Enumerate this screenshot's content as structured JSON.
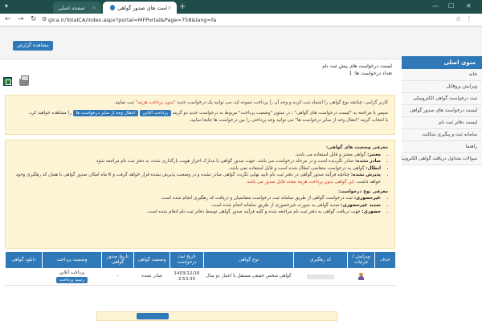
{
  "browser": {
    "tab1_title": "صفحه اصلی",
    "tab2_title": "لیست درخواست های صدور گواهی",
    "url": "gica.ir/TotalCA/index.aspx?portal=MFPortal&Page=758&lang=fa",
    "accent": "#1f4e4a"
  },
  "top": {
    "show_report": "مشاهده گزارش"
  },
  "sidebar": {
    "heading": "منوی اصلی",
    "items": [
      "خانه",
      "ویرایش پروفایل",
      "ثبت درخواست گواهی الکترونیکی",
      "لیست درخواست های صدور گواهی",
      "لیست دفاتر ثبت نام",
      "سامانه ثبت و پیگیری شکایت",
      "راهنما",
      "سوالات متداول دریافت گواهی الکترونیکی"
    ]
  },
  "summary": {
    "line1": "لیست درخواست های پیش ثبت نام",
    "line2": "تعداد درخواست ها: 1"
  },
  "note1": {
    "line1_a": "کاربر گرامی، چنانچه نوع گواهی را اشتباه ثبت کرده و وجه آن را پرداخت ننموده اید، می توانید یک درخواست جدید",
    "line1_red": "\"بدون پرداخت هزینه\"",
    "line1_b": "ثبت نمایید.",
    "line2_a": "سپس با مراجعه به \"لیست درخواست های گواهی\" ، در ستون \"وضعیت پرداخت\" مربوط به درخواست جدید دو گزینه",
    "btn_online": "پرداخت آنلاین",
    "btn_transfer": "انتقال وجه از سایر درخواست ها",
    "line2_b": "را مشاهده خواهید کرد.",
    "line3": "با انتخاب گزینه \"انتقال وجه از سایر درخواست ها\" می توانید وجه پرداختی را بین درخواست ها جابجا نمایید."
  },
  "note2": {
    "title1": "معرفی وضعیت های گواهی:",
    "s1_b": "معتبر:",
    "s1": "گواهی معتبر و قابل استفاده می باشد.",
    "s2_b": "صادر نشده:",
    "s2": "صادر نگردیده است و در مرحله درخواست می باشد. جهت صدور گواهی با مدارک احراز هویت بارگذاری شده، به دفتر ثبت نام مراجعه شود.",
    "s3_b": "ابطال:",
    "s3": "گواهی به درخواست متقاضی ابطال شده است و قابل استفاده نمی باشد.",
    "s4_b": "پذیرش نشده:",
    "s4": "چنانچه فرآیند صدور گواهی در دفتر ثبت نام تایید نهایی نگردد، گواهی صادر نشده و در وضعیت پذیرش نشده قرار خواهد گرفت و 6 ماه امکان صدور گواهی با همان کد رهگیری وجود خواهد داشت.",
    "s4_red": "این گواهی بدون پرداخت هزینه مجدد قابل صدور می باشد.",
    "title2": "معرفی نوع درخواست:",
    "t1_b": "غیرحضوری:",
    "t1": "ثبت درخواست گواهی از طریق سامانه ثبت درخواست متقاضیان و دریافت کد رهگیری انجام شده است.",
    "t2_b": "تمدید غیرحضوری:",
    "t2": "تمدید گواهی به صورت غیرحضوری از طریق سامانه انجام شده است.",
    "t3_b": "حضوری:",
    "t3": "جهت دریافت گواهی به دفتر ثبت نام مراجعه شده و کلیه فرآیند صدور گواهی توسط دفاتر ثبت نام انجام شده است."
  },
  "table": {
    "headers": {
      "download": "دانلود گواهی",
      "pay_status": "وضعیت پرداخت",
      "issue_date": "تاریخ صدور گواهی",
      "cert_status": "وضعیت گواهی",
      "reg_date": "تاریخ ثبت درخواست",
      "cert_type": "نوع گواهی",
      "tracking": "کد رهگیری",
      "edit": "ویرایش / جزئیات",
      "delete": "حذف"
    },
    "row": {
      "pay_status": "پرداخت آنلاین",
      "pay_btn": "رسید پرداخت",
      "issue_date": "-",
      "cert_status": "صادر نشده",
      "reg_date": "1403/12/16",
      "reg_time": "3:53:35",
      "cert_type": "گواهی شخص حقیقی مستقل با اعتبار دو سال"
    }
  }
}
